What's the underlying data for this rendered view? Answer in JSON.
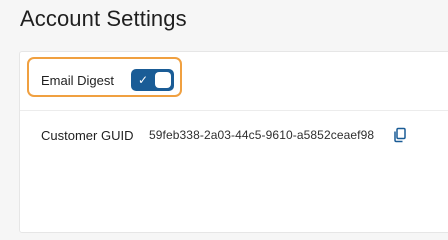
{
  "page": {
    "title": "Account Settings"
  },
  "settings": {
    "email_digest": {
      "label": "Email Digest",
      "enabled": true,
      "check_glyph": "✓"
    },
    "customer_guid": {
      "label": "Customer GUID",
      "value": "59feb338-2a03-44c5-9610-a5852ceaef98",
      "copy_icon": "copy-icon"
    }
  },
  "colors": {
    "toggle_on": "#1a5c96",
    "highlight": "#f0a040",
    "copy_icon": "#1a5c96"
  }
}
